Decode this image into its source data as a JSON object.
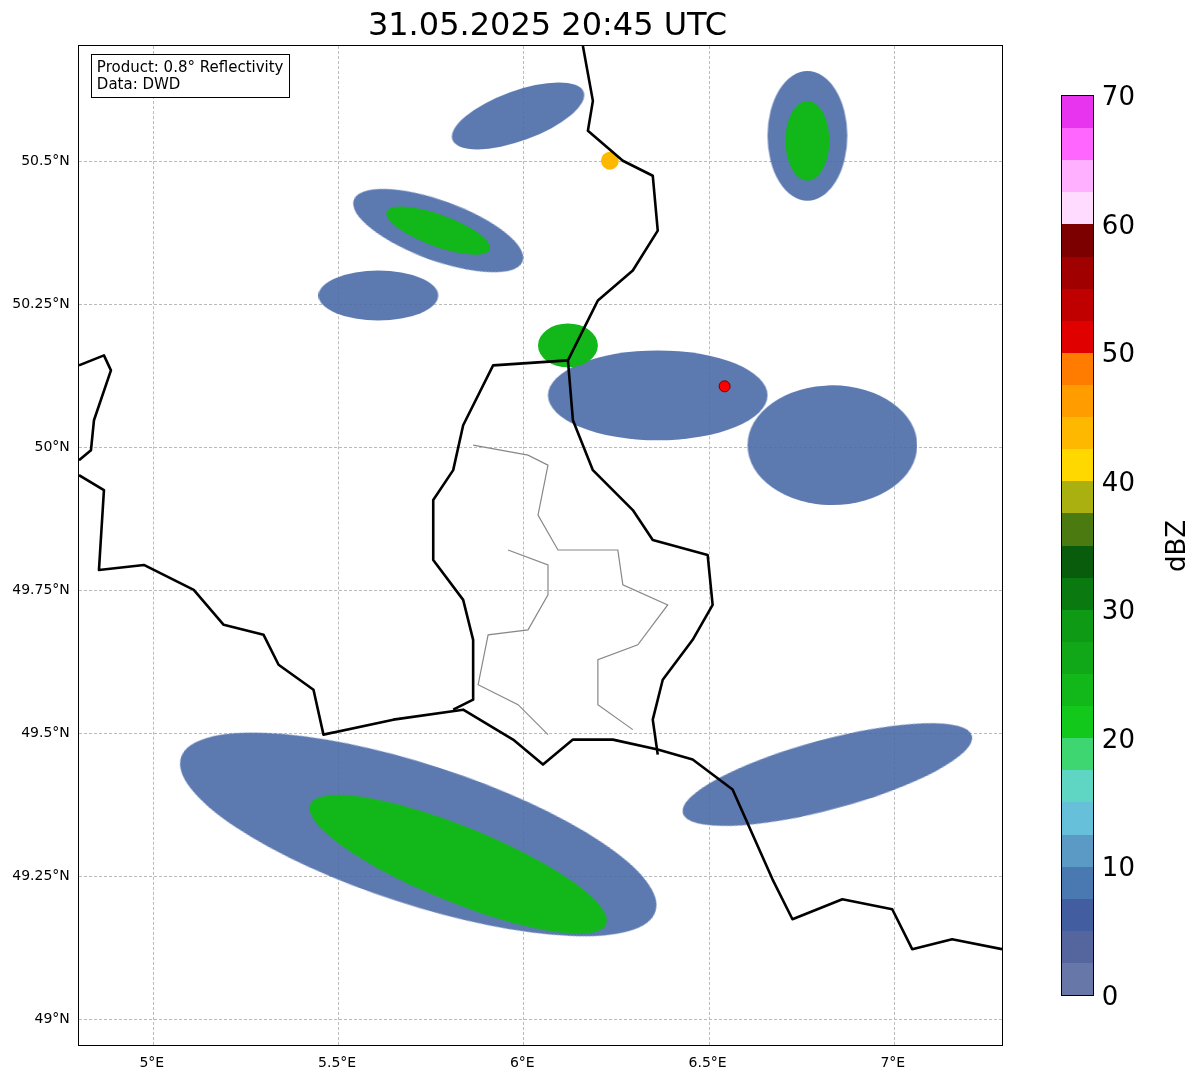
{
  "title": "31.05.2025 20:45 UTC",
  "annotation": {
    "lines": [
      "Product: 0.8° Reflectivity",
      "Data: DWD"
    ]
  },
  "map": {
    "xticks": [
      "5°E",
      "5.5°E",
      "6°E",
      "6.5°E",
      "7°E"
    ],
    "yticks": [
      "50.5°N",
      "50.25°N",
      "50°N",
      "49.75°N",
      "49.5°N",
      "49.25°N",
      "49°N"
    ]
  },
  "colorbar": {
    "label": "dBZ",
    "ticks": [
      "70",
      "60",
      "50",
      "40",
      "30",
      "20",
      "10",
      "0"
    ],
    "bands": [
      {
        "color": "#e834ee"
      },
      {
        "color": "#ff66ff"
      },
      {
        "color": "#ffb0ff"
      },
      {
        "color": "#ffdcff"
      },
      {
        "color": "#7c0000"
      },
      {
        "color": "#a00000"
      },
      {
        "color": "#c00000"
      },
      {
        "color": "#e00000"
      },
      {
        "color": "#ff7c00"
      },
      {
        "color": "#ff9c00"
      },
      {
        "color": "#ffb800"
      },
      {
        "color": "#ffd800"
      },
      {
        "color": "#aab010"
      },
      {
        "color": "#4a7a10"
      },
      {
        "color": "#085c0c"
      },
      {
        "color": "#0a7a10"
      },
      {
        "color": "#0e9a14"
      },
      {
        "color": "#10a818"
      },
      {
        "color": "#12b81a"
      },
      {
        "color": "#12c81a"
      },
      {
        "color": "#3ed670"
      },
      {
        "color": "#5fd6c4"
      },
      {
        "color": "#66c0da"
      },
      {
        "color": "#5a9ac4"
      },
      {
        "color": "#4a78b0"
      },
      {
        "color": "#425da0"
      },
      {
        "color": "#55669e"
      },
      {
        "color": "#6677a8"
      }
    ]
  }
}
